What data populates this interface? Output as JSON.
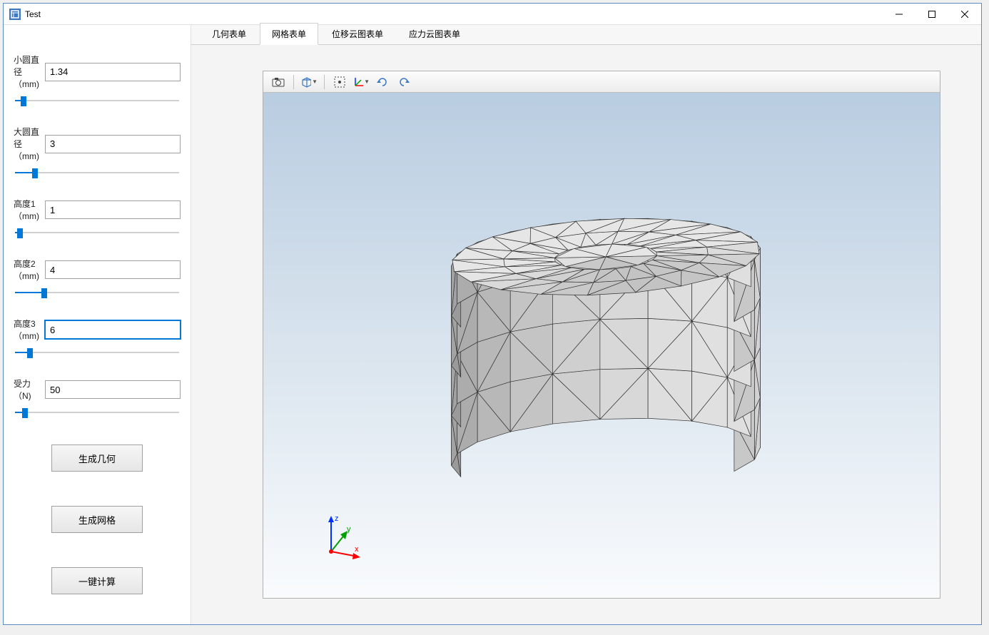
{
  "window": {
    "title": "Test"
  },
  "params": [
    {
      "label": "小圆直径（mm)",
      "value": "1.34",
      "slider_pct": 5
    },
    {
      "label": "大圆直径（mm)",
      "value": "3",
      "slider_pct": 12
    },
    {
      "label": "高度1（mm)",
      "value": "1",
      "slider_pct": 3
    },
    {
      "label": "高度2（mm)",
      "value": "4",
      "slider_pct": 18
    },
    {
      "label": "高度3（mm)",
      "value": "6",
      "slider_pct": 9,
      "focused": true
    },
    {
      "label": "受力（N)",
      "value": "50",
      "slider_pct": 6
    }
  ],
  "buttons": {
    "gen_geometry": "生成几何",
    "gen_mesh": "生成网格",
    "one_click": "一键计算"
  },
  "tabs": [
    {
      "id": "geom",
      "label": "几何表单",
      "active": false
    },
    {
      "id": "mesh",
      "label": "网格表单",
      "active": true
    },
    {
      "id": "disp",
      "label": "位移云图表单",
      "active": false
    },
    {
      "id": "stress",
      "label": "应力云图表单",
      "active": false
    }
  ],
  "toolbar_icons": [
    {
      "name": "camera-icon"
    },
    {
      "name": "cube-view-icon",
      "dropdown": true
    },
    {
      "name": "fit-all-icon"
    },
    {
      "name": "axes-icon",
      "dropdown": true
    },
    {
      "name": "rotate-cw-icon"
    },
    {
      "name": "rotate-ccw-icon"
    }
  ],
  "triad": {
    "x": "x",
    "y": "y",
    "z": "z"
  }
}
